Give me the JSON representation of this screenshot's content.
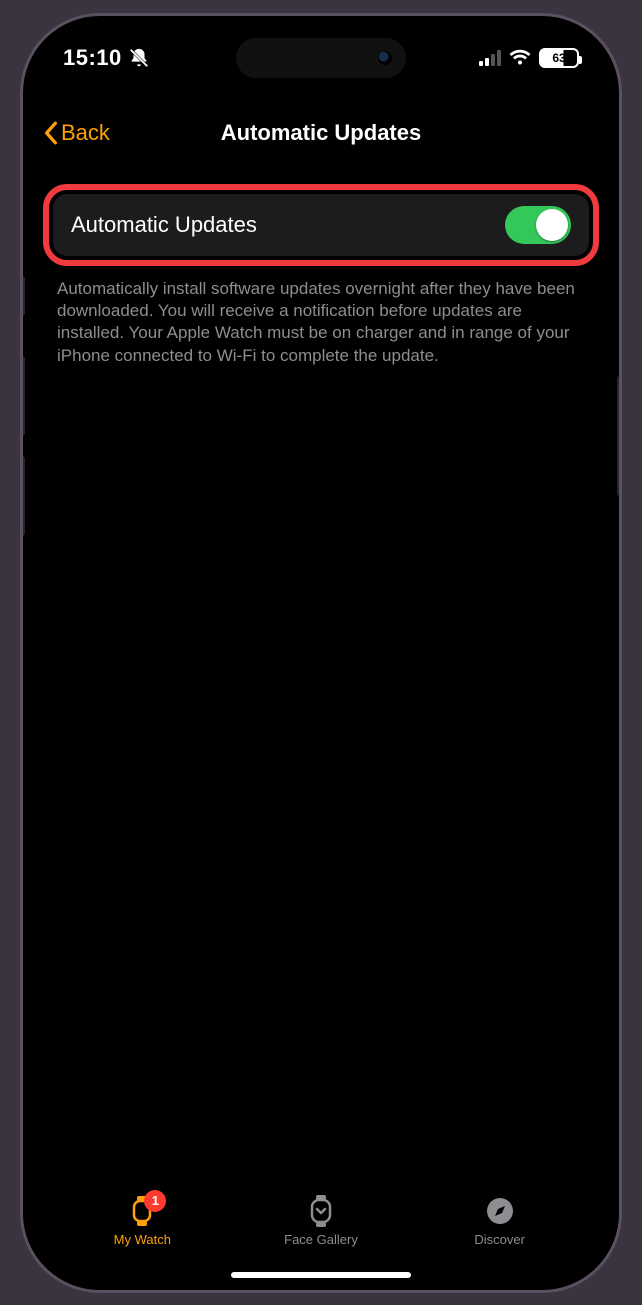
{
  "status": {
    "time": "15:10",
    "battery_pct": "63",
    "cell_active_bars": 2
  },
  "nav": {
    "back_label": "Back",
    "title": "Automatic Updates"
  },
  "setting": {
    "label": "Automatic Updates",
    "enabled": true
  },
  "footer_text": "Automatically install software updates overnight after they have been downloaded. You will receive a notification before updates are installed. Your Apple Watch must be on charger and in range of your iPhone connected to Wi-Fi to complete the update.",
  "tabs": [
    {
      "label": "My Watch",
      "icon": "watch-icon",
      "active": true,
      "badge": "1"
    },
    {
      "label": "Face Gallery",
      "icon": "watch-face-icon",
      "active": false
    },
    {
      "label": "Discover",
      "icon": "compass-icon",
      "active": false
    }
  ],
  "colors": {
    "accent_orange": "#ff9f0a",
    "toggle_green": "#34c759",
    "highlight_red": "#ef3b3e",
    "badge_red": "#ff3b30",
    "secondary_text": "#8d8d92",
    "row_bg": "#1c1c1e"
  }
}
